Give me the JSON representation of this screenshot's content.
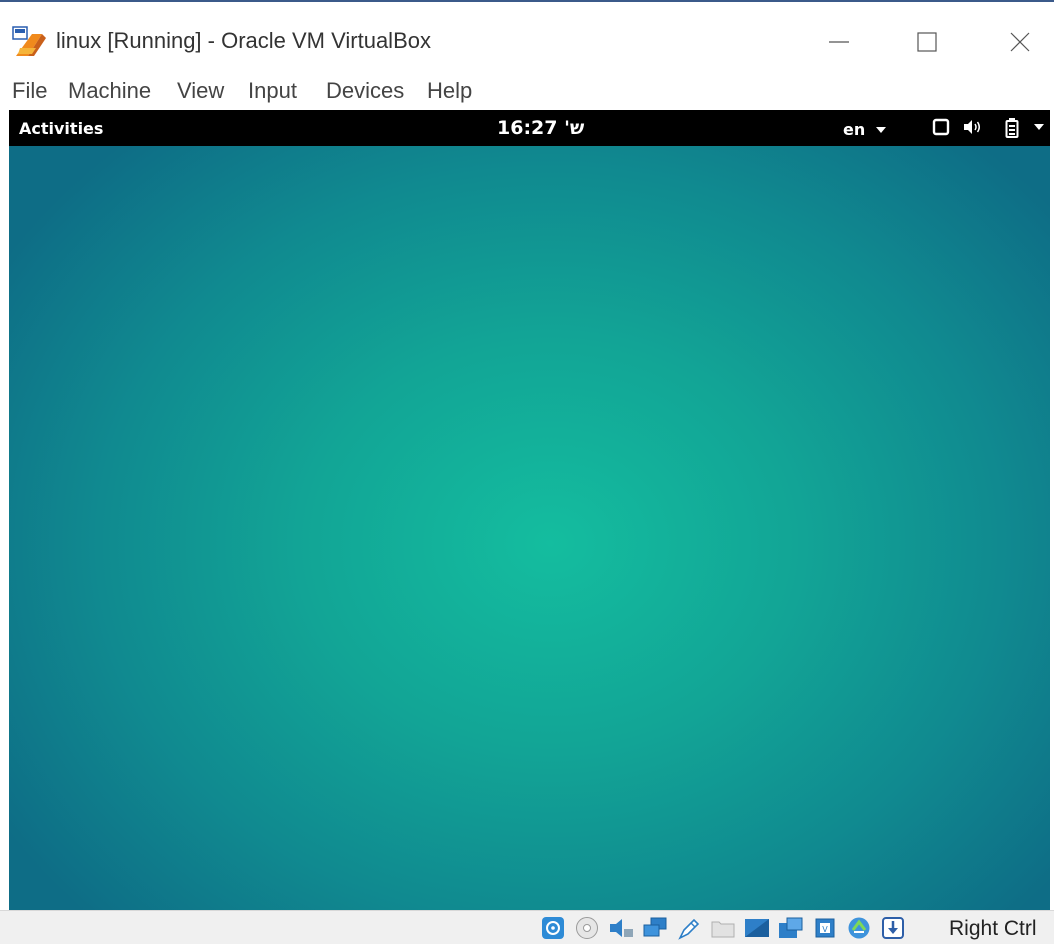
{
  "window": {
    "title": "linux [Running] - Oracle VM VirtualBox",
    "icon": "virtualbox-icon",
    "controls": [
      "minimize-icon",
      "maximize-icon",
      "close-icon"
    ]
  },
  "menubar": {
    "items": [
      "File",
      "Machine",
      "View",
      "Input",
      "Devices",
      "Help"
    ]
  },
  "guest": {
    "topbar": {
      "activities_label": "Activities",
      "clock": "16:27 'ש",
      "input_source": "en",
      "tray_icons": [
        "screen-icon",
        "volume-icon",
        "battery-icon",
        "system-menu-arrow-icon"
      ]
    },
    "desktop": {
      "background_center": "#14bd9f",
      "background_edge": "#0e6d86"
    }
  },
  "statusbar": {
    "icons": [
      "hard-disk-icon",
      "optical-drive-icon",
      "audio-icon",
      "network-icon",
      "usb-icon",
      "shared-folders-icon",
      "display-icon",
      "video-capture-icon",
      "cpu-icon",
      "mouse-integration-icon",
      "keyboard-capture-icon"
    ],
    "host_key": "Right Ctrl"
  },
  "colors": {
    "title_border": "#3b5a8a",
    "gnome_bar": "#000000",
    "statusbar_bg": "#f0f0f0"
  }
}
